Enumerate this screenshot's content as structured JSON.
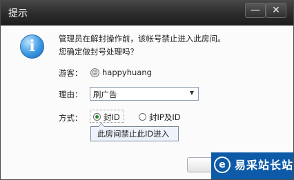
{
  "window": {
    "title": "提示",
    "minimize_glyph": "—",
    "close_glyph": "✕"
  },
  "message": {
    "line1": "管理员在解封操作前，该帐号禁止进入此房间。",
    "line2": "您确定做封号处理吗？",
    "icon": "info-icon"
  },
  "guest": {
    "label": "游客：",
    "username": "happyhuang",
    "avatar_glyph": "☺"
  },
  "reason": {
    "label": "理由：",
    "selected": "刷广告",
    "arrow": "▼"
  },
  "method": {
    "label": "方式：",
    "options": [
      {
        "label": "封ID",
        "selected": true
      },
      {
        "label": "封IP及ID",
        "selected": false
      }
    ]
  },
  "tooltip": {
    "text": "此房间禁止此ID进入"
  },
  "watermark": {
    "logo_glyph": "e",
    "text": "易采站长站"
  },
  "colors": {
    "titlebar": "#2b2b2b",
    "watermark": "#0d5aa8",
    "radio_selected": "#1f8c28"
  }
}
